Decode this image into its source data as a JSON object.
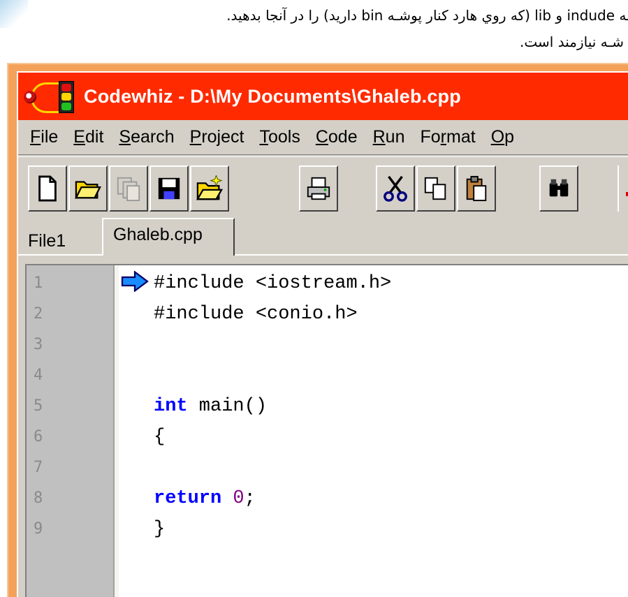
{
  "caption": {
    "line1": "ـه indude و lib (که روي هارد كنار پوشـه bin داريد) را در آنجا بدهيد.",
    "line2": "شـه نيازمند است."
  },
  "window": {
    "title": "Codewhiz - D:\\My Documents\\Ghaleb.cpp",
    "title_bar_color": "#ff2a00",
    "frame_color": "#f4a25a"
  },
  "menu": {
    "items": [
      {
        "label": "File",
        "mnemonic": "F"
      },
      {
        "label": "Edit",
        "mnemonic": "E"
      },
      {
        "label": "Search",
        "mnemonic": "S"
      },
      {
        "label": "Project",
        "mnemonic": "P"
      },
      {
        "label": "Tools",
        "mnemonic": "T"
      },
      {
        "label": "Code",
        "mnemonic": "C"
      },
      {
        "label": "Run",
        "mnemonic": "R"
      },
      {
        "label": "Format",
        "mnemonic": "r"
      },
      {
        "label": "Op",
        "mnemonic": "O"
      }
    ]
  },
  "toolbar": {
    "buttons": [
      "new-file-icon",
      "open-folder-icon",
      "copy-files-icon",
      "save-icon",
      "new-project-icon",
      "print-icon",
      "cut-icon",
      "copy-icon",
      "paste-icon",
      "find-icon"
    ]
  },
  "tabs": {
    "items": [
      {
        "label": "File1",
        "active": false
      },
      {
        "label": "Ghaleb.cpp",
        "active": true
      }
    ]
  },
  "editor": {
    "line_numbers": [
      "1",
      "2",
      "3",
      "4",
      "5",
      "6",
      "7",
      "8",
      "9"
    ],
    "lines": [
      {
        "plain": "#include <iostream.h>"
      },
      {
        "plain": "#include <conio.h>"
      },
      {
        "plain": ""
      },
      {
        "plain": ""
      },
      {
        "keyword": "int",
        "rest": " main()"
      },
      {
        "plain": "{"
      },
      {
        "plain": ""
      },
      {
        "keyword": "return",
        "rest_pre": " ",
        "number": "0",
        "rest": ";"
      },
      {
        "plain": "}"
      }
    ],
    "keyword_color": "#0000ff",
    "number_color": "#800080",
    "current_line_marker": "1"
  }
}
